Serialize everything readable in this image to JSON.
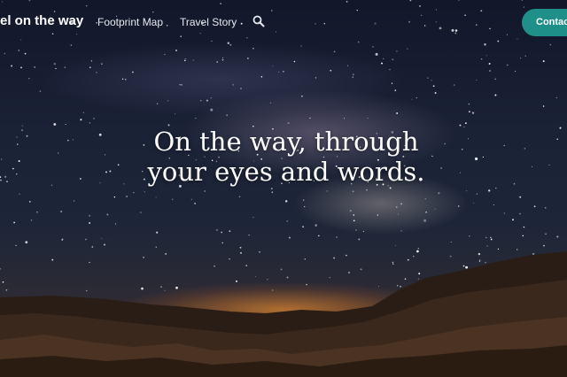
{
  "nav": {
    "brand": "el on the way",
    "links": [
      {
        "label": "Footprint Map"
      },
      {
        "label": "Travel Story"
      }
    ],
    "search_icon": "search-icon",
    "contact_label": "Contact",
    "accent_color": "#1f8f8a"
  },
  "hero": {
    "headline_line1": "On the way, through",
    "headline_line2": "your eyes and words."
  }
}
